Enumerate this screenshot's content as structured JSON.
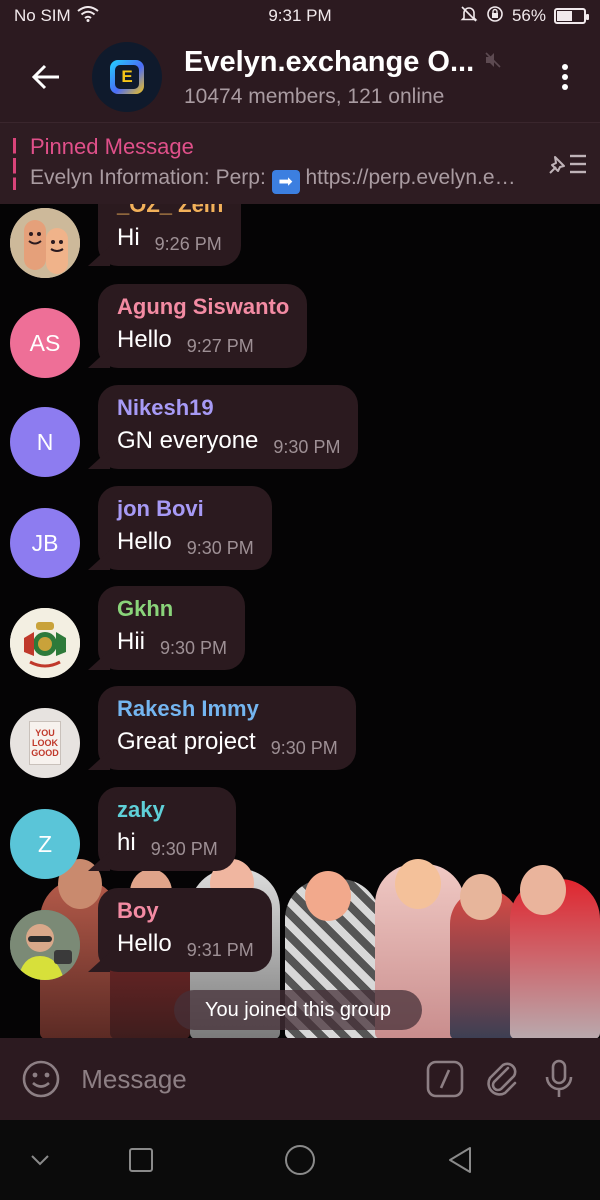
{
  "status": {
    "carrier": "No SIM",
    "time": "9:31 PM",
    "battery": "56%",
    "battery_level": 0.56
  },
  "header": {
    "title": "Evelyn.exchange O...",
    "subtitle": "10474 members, 121 online",
    "avatar_letter": "E"
  },
  "pinned": {
    "label": "Pinned Message",
    "text_prefix": "Evelyn Information:  Perp: ",
    "text_link": " https://perp.evelyn.exchange"
  },
  "messages": [
    {
      "sender": "_OZ_ Zein",
      "text": "Hi",
      "time": "9:26 PM",
      "initials": "",
      "color": "#f2b15a",
      "avatar_bg": "#d8cbb0"
    },
    {
      "sender": "Agung Siswanto",
      "text": "Hello",
      "time": "9:27 PM",
      "initials": "AS",
      "color": "#f38ba3",
      "avatar_bg": "#ee6f97"
    },
    {
      "sender": "Nikesh19",
      "text": "GN everyone",
      "time": "9:30 PM",
      "initials": "N",
      "color": "#a79af5",
      "avatar_bg": "#8d7cf0"
    },
    {
      "sender": "jon Bovi",
      "text": "Hello",
      "time": "9:30 PM",
      "initials": "JB",
      "color": "#a79af5",
      "avatar_bg": "#8d7cf0"
    },
    {
      "sender": "Gkhn",
      "text": "Hii",
      "time": "9:30 PM",
      "initials": "",
      "color": "#8ad47a",
      "avatar_bg": "#f3efe2"
    },
    {
      "sender": "Rakesh Immy",
      "text": "Great project",
      "time": "9:30 PM",
      "initials": "",
      "color": "#74b5f0",
      "avatar_bg": "#e7e3e0"
    },
    {
      "sender": "zaky",
      "text": "hi",
      "time": "9:30 PM",
      "initials": "Z",
      "color": "#5fd0d8",
      "avatar_bg": "#5ac5d8"
    },
    {
      "sender": "Boy",
      "text": "Hello",
      "time": "9:31 PM",
      "initials": "",
      "color": "#f38ba3",
      "avatar_bg": "#6b7a6a"
    }
  ],
  "rakesh_avatar_text": "YOU LOOK GOOD",
  "system_message": "You joined this group",
  "composer": {
    "placeholder": "Message"
  },
  "icons": {
    "back": "arrow-left",
    "mute": "speaker-muted",
    "menu": "vertical-dots",
    "pinned_list": "pin-list",
    "emoji": "smiley",
    "commands": "slash-box",
    "attach": "paperclip",
    "voice": "microphone"
  },
  "colors": {
    "bar_bg": "#2c1a20",
    "bubble_bg": "#2b1a1f",
    "accent_pink": "#e0508a"
  }
}
